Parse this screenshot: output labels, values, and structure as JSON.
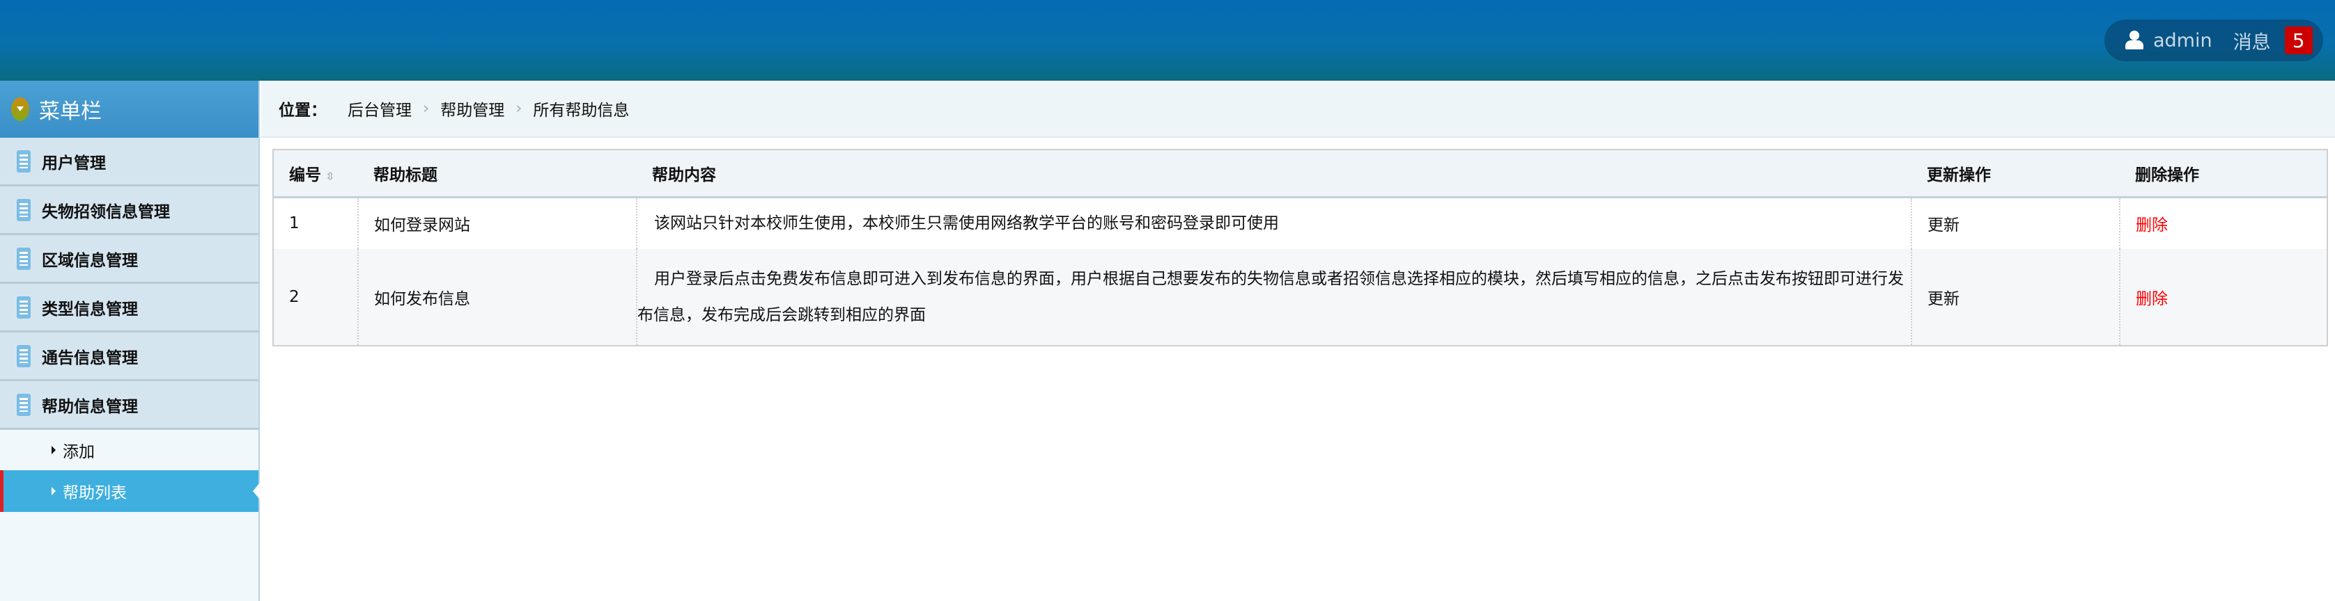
{
  "header": {
    "user": "admin",
    "messages_label": "消息",
    "message_count": "5"
  },
  "sidebar": {
    "title": "菜单栏",
    "items": [
      {
        "label": "用户管理"
      },
      {
        "label": "失物招领信息管理"
      },
      {
        "label": "区域信息管理"
      },
      {
        "label": "类型信息管理"
      },
      {
        "label": "通告信息管理"
      },
      {
        "label": "帮助信息管理"
      }
    ],
    "subitems": [
      {
        "label": "添加"
      },
      {
        "label": "帮助列表"
      }
    ]
  },
  "breadcrumb": {
    "label": "位置：",
    "items": [
      "后台管理",
      "帮助管理",
      "所有帮助信息"
    ]
  },
  "table": {
    "headers": [
      "编号",
      "帮助标题",
      "帮助内容",
      "更新操作",
      "删除操作"
    ],
    "rows": [
      {
        "id": "1",
        "title": "如何登录网站",
        "content": "该网站只针对本校师生使用，本校师生只需使用网络教学平台的账号和密码登录即可使用",
        "update": "更新",
        "delete": "删除"
      },
      {
        "id": "2",
        "title": "如何发布信息",
        "content": "用户登录后点击免费发布信息即可进入到发布信息的界面，用户根据自己想要发布的失物信息或者招领信息选择相应的模块，然后填写相应的信息，之后点击发布按钮即可进行发布信息，发布完成后会跳转到相应的界面",
        "update": "更新",
        "delete": "删除"
      }
    ]
  }
}
